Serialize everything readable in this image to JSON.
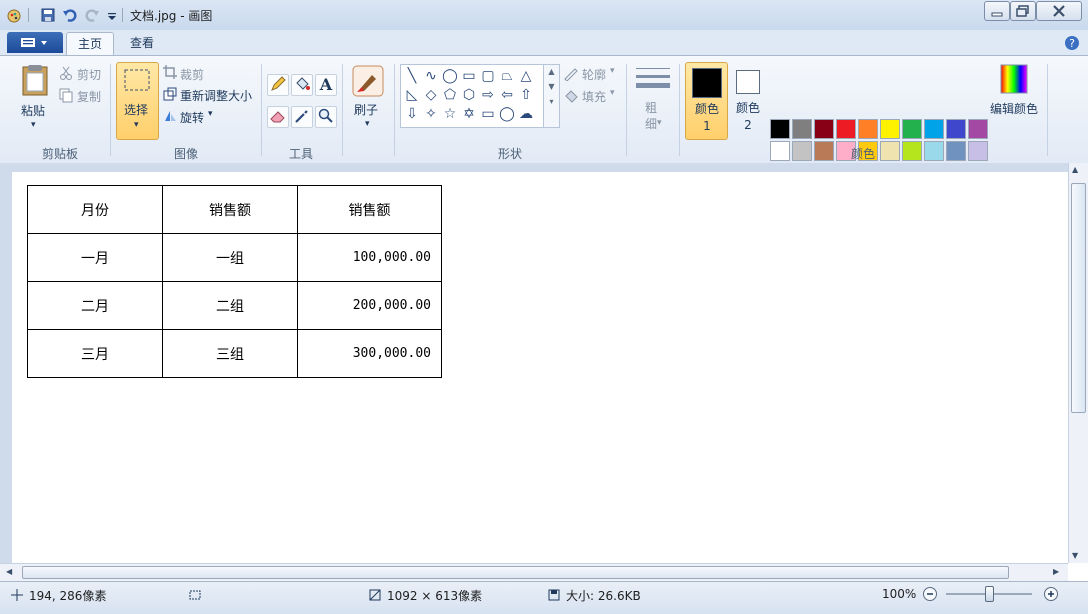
{
  "window": {
    "title": "文档.jpg - 画图"
  },
  "tabs": {
    "home": "主页",
    "view": "查看"
  },
  "ribbon": {
    "clipboard": {
      "paste": "粘贴",
      "cut": "剪切",
      "copy": "复制",
      "label": "剪贴板"
    },
    "image": {
      "select": "选择",
      "crop": "裁剪",
      "resize": "重新调整大小",
      "rotate": "旋转",
      "label": "图像"
    },
    "tools": {
      "label": "工具"
    },
    "brushes": {
      "label": "刷子"
    },
    "shapes": {
      "outline": "轮廓",
      "fill": "填充",
      "label": "形状"
    },
    "size": {
      "label": "粗细"
    },
    "colors": {
      "color1": "颜色 1",
      "color2": "颜色 2",
      "edit": "编辑颜色",
      "label": "颜色",
      "color1_value": "#000000",
      "color2_value": "#ffffff",
      "palette_row1": [
        "#000000",
        "#7f7f7f",
        "#880015",
        "#ed1c24",
        "#ff7f27",
        "#fff200",
        "#22b14c",
        "#00a2e8",
        "#3f48cc",
        "#a349a4"
      ],
      "palette_row2": [
        "#ffffff",
        "#c3c3c3",
        "#b97a57",
        "#ffaec9",
        "#ffc90e",
        "#efe4b0",
        "#b5e61d",
        "#99d9ea",
        "#7092be",
        "#c8bfe7"
      ],
      "palette_row3": [
        "#f0f0f0",
        "#f0f0f0",
        "#f0f0f0",
        "#f0f0f0",
        "#f0f0f0",
        "#f0f0f0",
        "#f0f0f0",
        "#f0f0f0",
        "#f0f0f0",
        "#f0f0f0"
      ]
    }
  },
  "document": {
    "table": {
      "rows": [
        [
          "月份",
          "销售额",
          "销售额"
        ],
        [
          "一月",
          "一组",
          "100,000.00"
        ],
        [
          "二月",
          "二组",
          "200,000.00"
        ],
        [
          "三月",
          "三组",
          "300,000.00"
        ]
      ]
    }
  },
  "status": {
    "cursor": "194, 286像素",
    "dimensions": "1092 × 613像素",
    "size": "大小: 26.6KB",
    "zoom": "100%"
  }
}
